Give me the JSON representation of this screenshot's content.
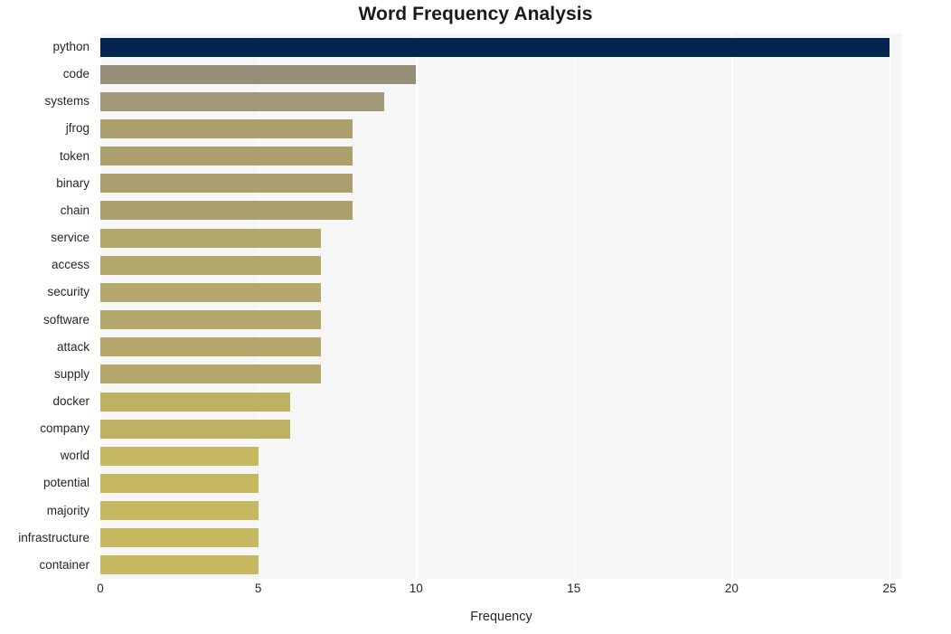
{
  "chart_data": {
    "type": "bar",
    "orientation": "horizontal",
    "title": "Word Frequency Analysis",
    "xlabel": "Frequency",
    "ylabel": "",
    "xlim": [
      0,
      25.4
    ],
    "xticks": [
      0,
      5,
      10,
      15,
      20,
      25
    ],
    "xticklabels": [
      "0",
      "5",
      "10",
      "15",
      "20",
      "25"
    ],
    "grid": "vertical-only",
    "legend": "none",
    "categories": [
      "python",
      "code",
      "systems",
      "jfrog",
      "token",
      "binary",
      "chain",
      "service",
      "access",
      "security",
      "software",
      "attack",
      "supply",
      "docker",
      "company",
      "world",
      "potential",
      "majority",
      "infrastructure",
      "container"
    ],
    "values": [
      25,
      10,
      9,
      8,
      8,
      8,
      8,
      7,
      7,
      7,
      7,
      7,
      7,
      6,
      6,
      5,
      5,
      5,
      5,
      5
    ],
    "bar_colors": [
      "#04254e",
      "#968f78",
      "#a09878",
      "#aa9f6d",
      "#aa9f6d",
      "#aa9f6d",
      "#aa9f6d",
      "#b3a76c",
      "#b3a76c",
      "#b3a76c",
      "#b3a76c",
      "#b3a76c",
      "#b3a76c",
      "#bfb164",
      "#bfb164",
      "#c6b860",
      "#c6b860",
      "#c6b860",
      "#c6b860",
      "#c6b860"
    ],
    "colors": {
      "plot_background": "#f6f6f7",
      "figure_background": "#ffffff",
      "gridline": "#ffffff",
      "text": "#262626",
      "title": "#1a1a1a",
      "highlight_bar": "#04254e"
    }
  }
}
